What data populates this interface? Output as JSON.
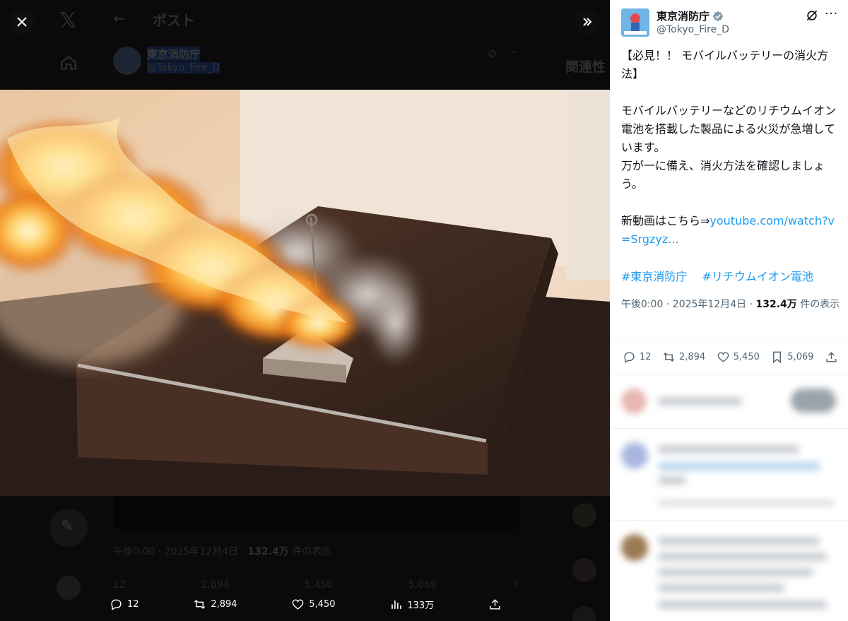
{
  "background_page": {
    "header_title": "ポスト",
    "author_name": "東京消防庁",
    "author_handle": "@Tokyo_Fire_D",
    "right_section_title": "関連性",
    "meta_time": "午後0:00 · 2025年12月4日 · ",
    "meta_views": "132.4万",
    "meta_views_suffix": " 件の表示",
    "actions": [
      "12",
      "2,894",
      "5,450",
      "5,069"
    ]
  },
  "viewer": {
    "close_icon": "close-icon",
    "expand_icon": "double-chevron-right-icon",
    "actions": {
      "replies": "12",
      "reposts": "2,894",
      "likes": "5,450",
      "views": "133万"
    }
  },
  "post": {
    "author_name": "東京消防庁",
    "author_handle": "@Tokyo_Fire_D",
    "verified": true,
    "text_title": "【必見！！ モバイルバッテリーの消火方法】",
    "text_body": "モバイルバッテリーなどのリチウムイオン電池を搭載した製品による火災が急増しています。\n万が一に備え、消火方法を確認しましょう。",
    "text_link_prefix": "新動画はこちら⇒",
    "link": "youtube.com/watch?v=Srgzyz...",
    "hashtags": [
      "#東京消防庁",
      "#リチウムイオン電池"
    ],
    "meta_time": "午後0:00 · 2025年12月4日 · ",
    "meta_views": "132.4万",
    "meta_views_suffix": " 件の表示",
    "actions": {
      "replies": "12",
      "reposts": "2,894",
      "likes": "5,450",
      "bookmarks": "5,069"
    }
  },
  "colors": {
    "link": "#1d9bf0",
    "verified": "#829aab",
    "text": "#0f1419",
    "muted": "#536471"
  }
}
